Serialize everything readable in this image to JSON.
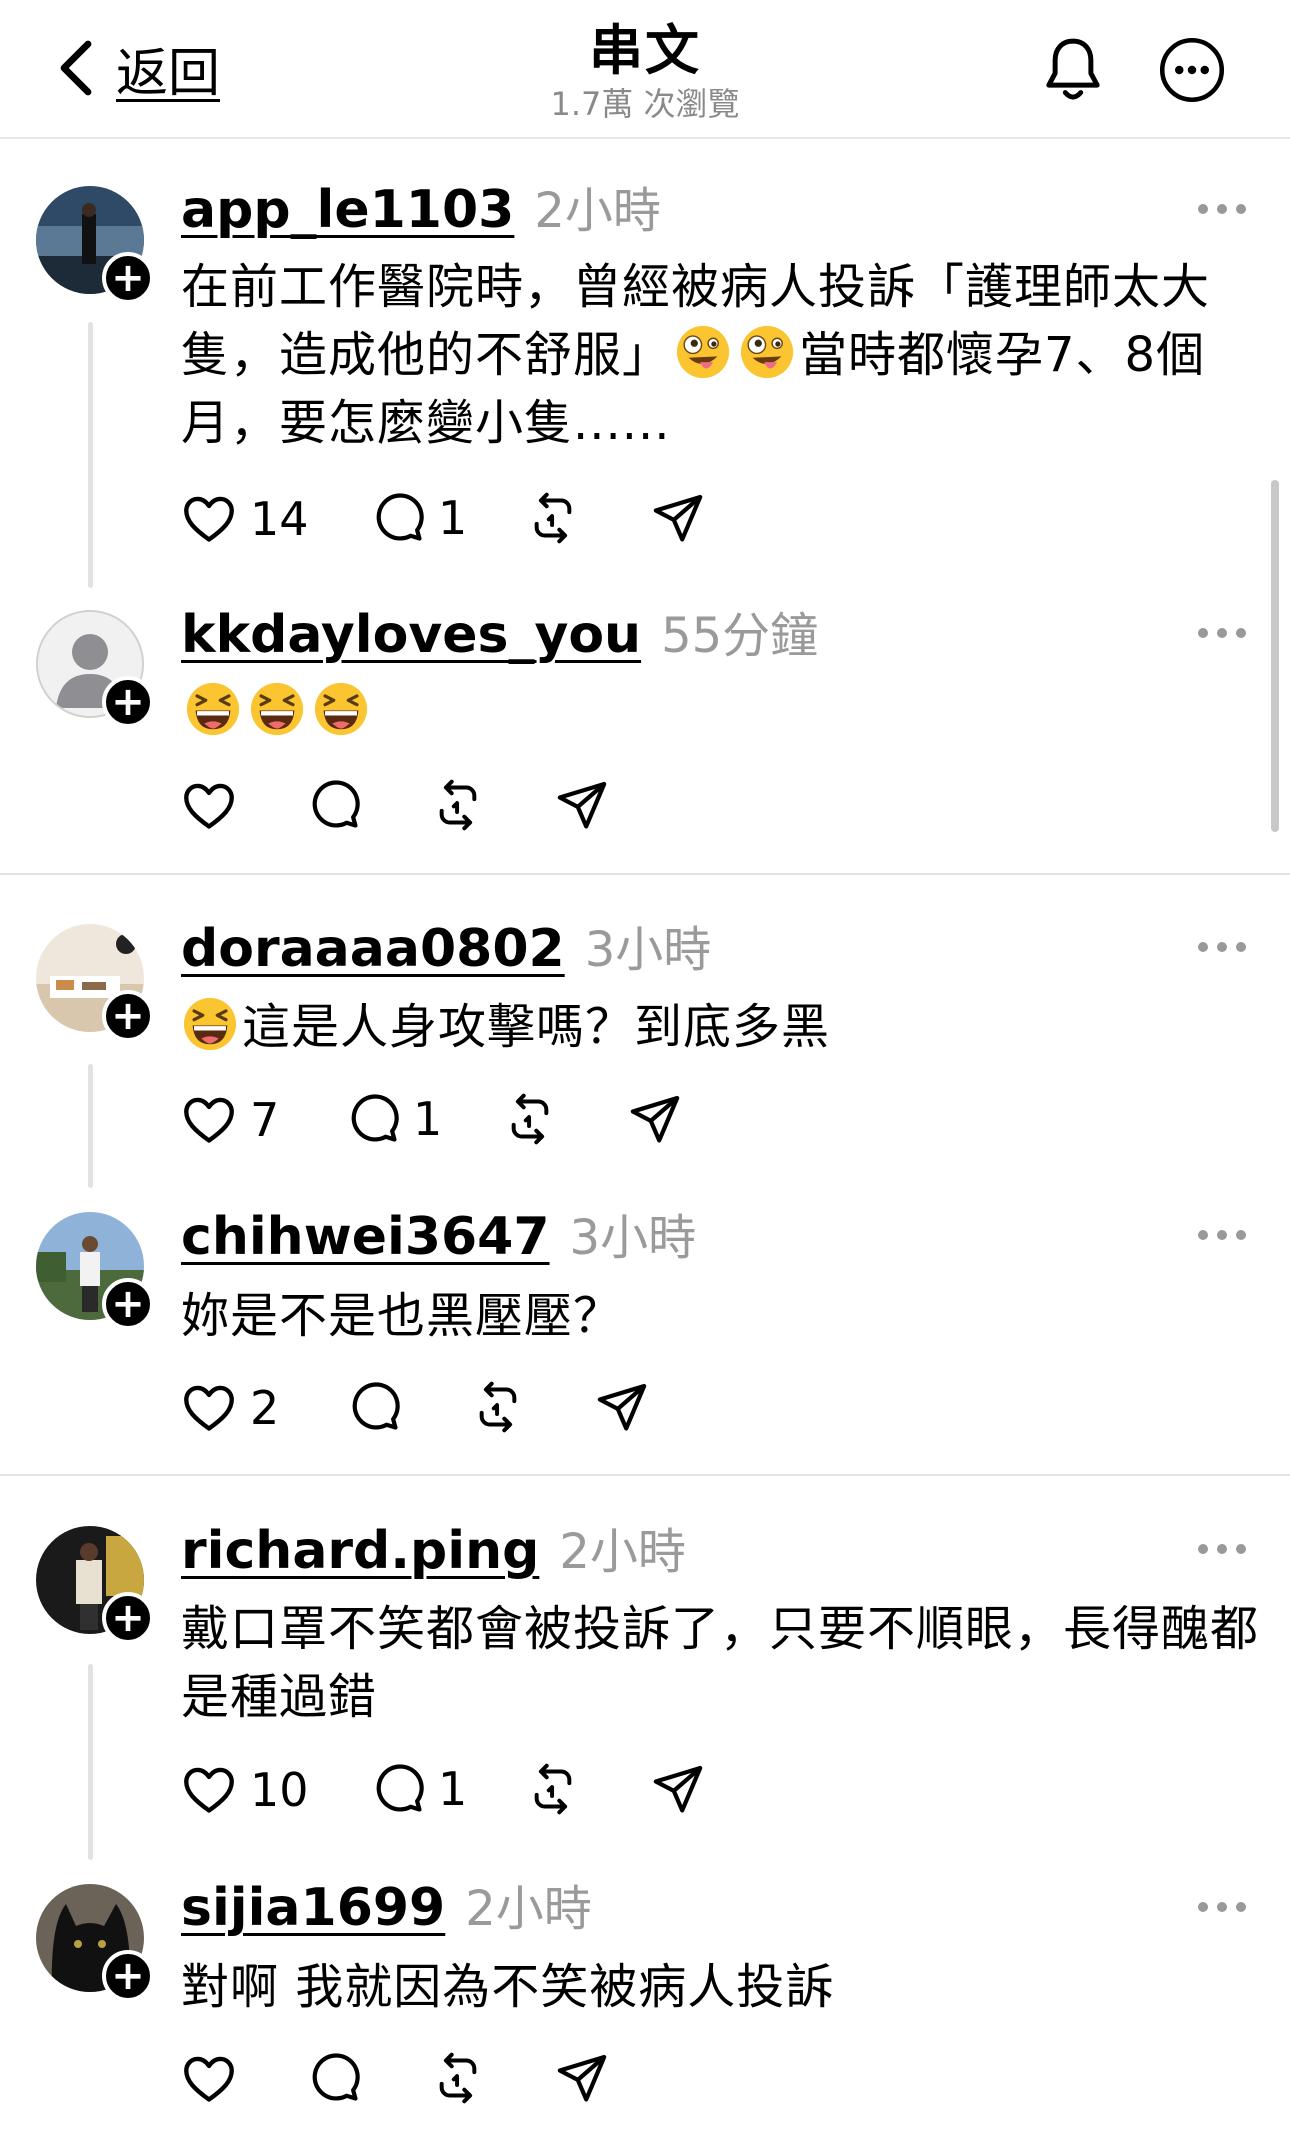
{
  "header": {
    "back_label": "返回",
    "title": "串文",
    "views": "1.7萬 次瀏覽"
  },
  "posts": [
    {
      "username": "app_le1103",
      "time": "2小時",
      "text_before": "在前工作醫院時，曾經被病人投訴「護理師太大隻，造成他的不舒服」",
      "text_after": "當時都懷孕7、8個月，要怎麼變小隻......",
      "emoji": [
        "zany-face-emoji",
        "zany-face-emoji"
      ],
      "likes": "14",
      "replies": "1"
    },
    {
      "username": "kkdayloves_you",
      "time": "55分鐘",
      "emoji": [
        "grinning-squinting-face-emoji",
        "grinning-squinting-face-emoji",
        "grinning-squinting-face-emoji"
      ],
      "likes": "",
      "replies": ""
    },
    {
      "username": "doraaaa0802",
      "time": "3小時",
      "text": "這是人身攻擊嗎？到底多黑",
      "emoji": [
        "grinning-squinting-face-emoji"
      ],
      "likes": "7",
      "replies": "1"
    },
    {
      "username": "chihwei3647",
      "time": "3小時",
      "text": "妳是不是也黑壓壓？",
      "likes": "2",
      "replies": ""
    },
    {
      "username": "richard.ping",
      "time": "2小時",
      "text": "戴口罩不笑都會被投訴了，只要不順眼，長得醜都是種過錯",
      "likes": "10",
      "replies": "1"
    },
    {
      "username": "sijia1699",
      "time": "2小時",
      "text": "對啊 我就因為不笑被病人投訴",
      "likes": "",
      "replies": ""
    }
  ],
  "icons": {
    "back": "chevron-left-icon",
    "bell": "bell-icon",
    "more": "more-circle-icon",
    "like": "heart-icon",
    "reply": "comment-icon",
    "repost": "repost-icon",
    "share": "send-icon"
  }
}
